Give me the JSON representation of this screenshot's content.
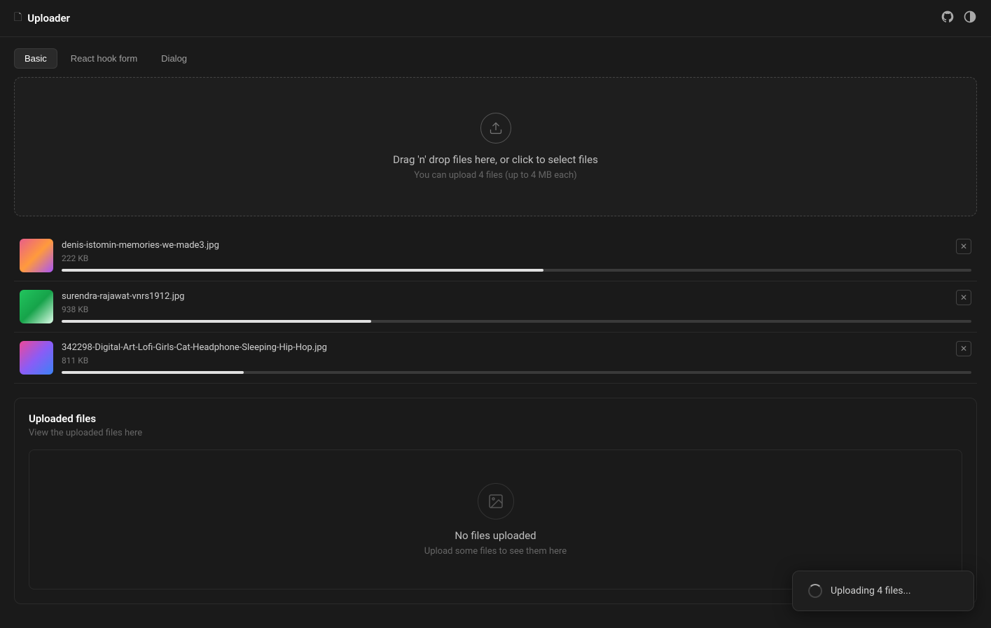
{
  "header": {
    "title": "Uploader",
    "doc_icon": "📄",
    "github_label": "github",
    "theme_label": "theme-toggle"
  },
  "tabs": [
    {
      "id": "basic",
      "label": "Basic",
      "active": true
    },
    {
      "id": "react-hook-form",
      "label": "React hook form",
      "active": false
    },
    {
      "id": "dialog",
      "label": "Dialog",
      "active": false
    }
  ],
  "dropzone": {
    "title": "Drag 'n' drop files here, or click to select files",
    "subtitle": "You can upload 4 files (up to 4 MB each)"
  },
  "files": [
    {
      "name": "denis-istomin-memories-we-made3.jpg",
      "size": "222 KB",
      "progress": 53,
      "thumb_type": "gradient1"
    },
    {
      "name": "surendra-rajawat-vnrs1912.jpg",
      "size": "938 KB",
      "progress": 34,
      "thumb_type": "gradient2"
    },
    {
      "name": "342298-Digital-Art-Lofi-Girls-Cat-Headphone-Sleeping-Hip-Hop.jpg",
      "size": "811 KB",
      "progress": 20,
      "thumb_type": "gradient3"
    }
  ],
  "uploaded_section": {
    "title": "Uploaded files",
    "subtitle": "View the uploaded files here",
    "empty_title": "No files uploaded",
    "empty_subtitle": "Upload some files to see them here"
  },
  "toast": {
    "text": "Uploading 4 files..."
  },
  "colors": {
    "accent": "#ffffff",
    "background": "#1a1a1a",
    "border": "#2a2a2a"
  }
}
